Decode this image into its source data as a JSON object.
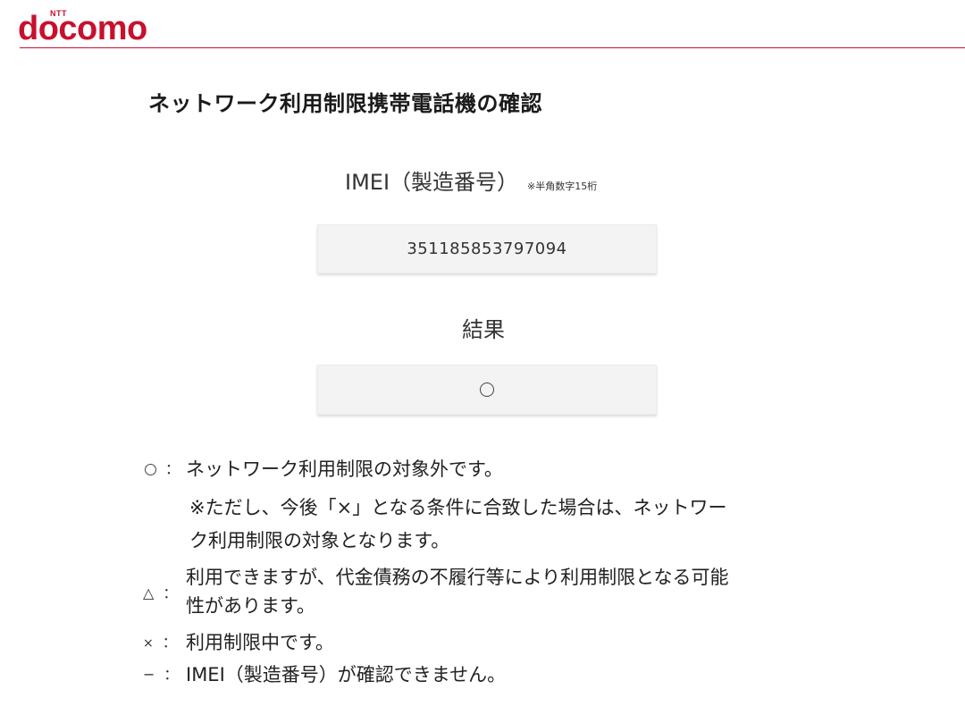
{
  "brand": {
    "corp": "NTT",
    "name": "docomo",
    "color": "#c8102e"
  },
  "page_title": "ネットワーク利用制限携帯電話機の確認",
  "imei": {
    "label": "IMEI（製造番号）",
    "note": "※半角数字15桁",
    "value": "351185853797094"
  },
  "result": {
    "label": "結果",
    "value_icon": "circle-icon"
  },
  "legend": {
    "circle": {
      "symbol_icon": "circle-icon",
      "colon": "：",
      "text": "ネットワーク利用制限の対象外です。",
      "note_line1": "※ただし、今後「×」となる条件に合致した場合は、ネットワー",
      "note_line2": "ク利用制限の対象となります。"
    },
    "triangle": {
      "symbol": "△",
      "colon": "：",
      "text_line1": "利用できますが、代金債務の不履行等により利用制限となる可能",
      "text_line2": "性があります。"
    },
    "cross": {
      "symbol": "×",
      "colon": "：",
      "text": "利用制限中です。"
    },
    "dash": {
      "symbol": "−",
      "colon": "：",
      "text": "IMEI（製造番号）が確認できません。"
    }
  }
}
